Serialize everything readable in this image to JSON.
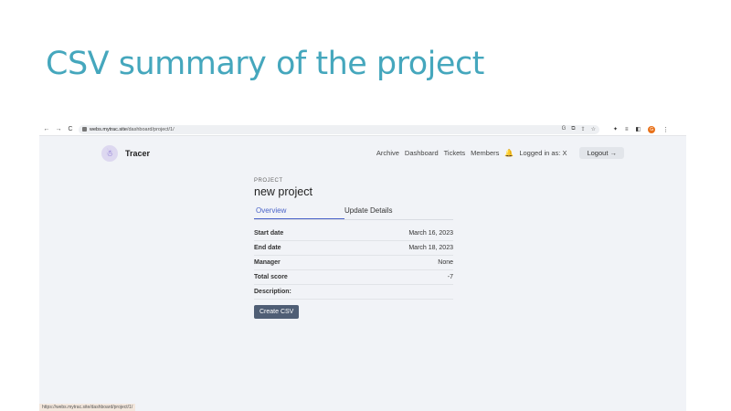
{
  "slide": {
    "title": "CSV summary of the project"
  },
  "browser": {
    "back": "←",
    "forward": "→",
    "reload": "C",
    "url_host": "webs.mytrac.site",
    "url_path": "/dashboard/project/1/",
    "omni_icons": [
      "G",
      "⧉",
      "⇪",
      "☆"
    ],
    "ext_icons": [
      "✦",
      "≡",
      "◧"
    ],
    "profile_initial": "G",
    "menu": "⋮",
    "status_url": "https://webs.mytrac.site/dashboard/project/1/"
  },
  "app": {
    "brand": "Tracer",
    "logo_glyph": "☃",
    "nav": [
      "Archive",
      "Dashboard",
      "Tickets",
      "Members"
    ],
    "bell": "🔔",
    "logged_in": "Logged in as:  X",
    "logout": "Logout →"
  },
  "project": {
    "eyebrow": "PROJECT",
    "name": "new project",
    "tabs": [
      "Overview",
      "Update Details"
    ],
    "details": [
      {
        "label": "Start date",
        "value": "March 16, 2023"
      },
      {
        "label": "End date",
        "value": "March 18, 2023"
      },
      {
        "label": "Manager",
        "value": "None"
      },
      {
        "label": "Total score",
        "value": "-7"
      },
      {
        "label": "Description:",
        "value": ""
      }
    ],
    "create_csv": "Create CSV"
  },
  "colors": {
    "title": "#45a7bd",
    "accent": "#4a63c8",
    "button": "#4f5e75"
  }
}
